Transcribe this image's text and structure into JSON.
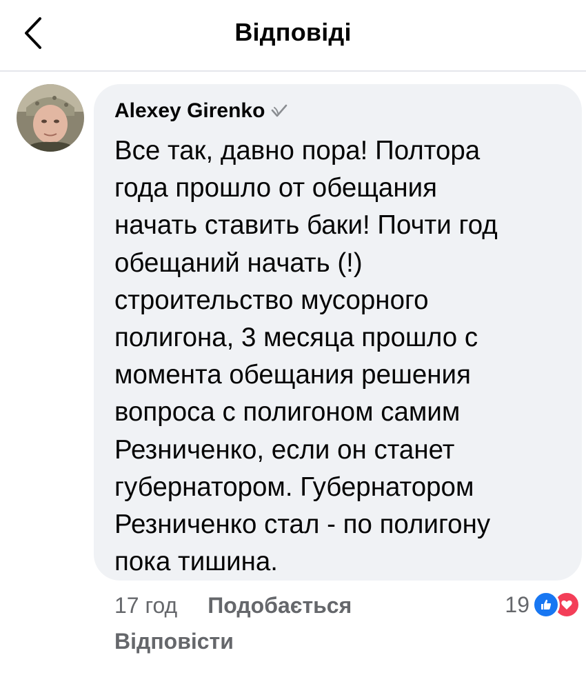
{
  "header": {
    "title": "Відповіді",
    "back_icon": "chevron-left-icon"
  },
  "comment": {
    "author": "Alexey Girenko",
    "badge_icon": "top-fan-badge-icon",
    "text": "Все так, давно пора! Полтора\nгода прошло от обещания\nначать ставить баки! Почти год\nобещаний начать (!)\nстроительство мусорного\nполигона, 3 месяца прошло с\nмомента обещания решения\nвопроса с полигоном самим\nРезниченко, если он станет\nгубернатором. Губернатором\nРезниченко стал - по полигону\nпока тишина.",
    "time": "17 год",
    "like_label": "Подобається",
    "reply_label": "Відповісти",
    "reaction_count": "19",
    "reaction_icons": [
      "like-reaction-icon",
      "love-reaction-icon"
    ]
  },
  "colors": {
    "bubble_bg": "#f0f2f5",
    "meta_text": "#65676b",
    "like_blue": "#1877f2",
    "love_red": "#f33e58"
  }
}
